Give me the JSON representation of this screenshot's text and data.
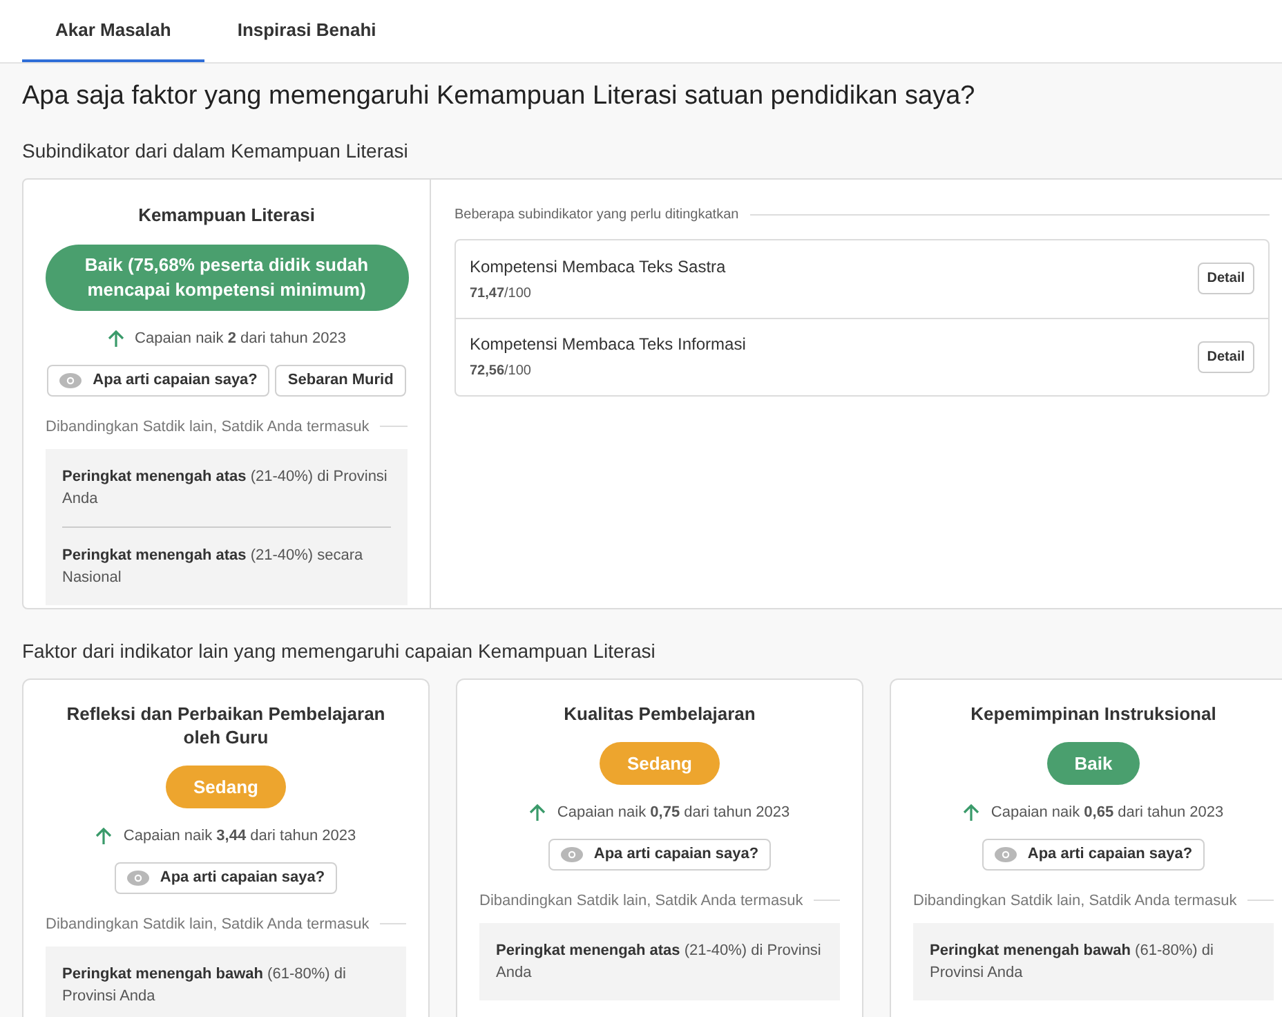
{
  "tabs": [
    {
      "label": "Akar Masalah",
      "selected": true
    },
    {
      "label": "Inspirasi Benahi",
      "selected": false
    }
  ],
  "title": "Apa saja faktor yang memengaruhi Kemampuan Literasi satuan pendidikan saya?",
  "main_section": {
    "heading": "Subindikator dari dalam Kemampuan Literasi",
    "summary": {
      "title": "Kemampuan Literasi",
      "badge": "Baik (75,68% peserta didik sudah mencapai kompetensi minimum)",
      "color": "#4a9f6e",
      "trend": "Capaian naik **2** dari tahun 2023",
      "buttons": [
        {
          "label": "Apa arti capaian saya?",
          "kind": "eye"
        },
        {
          "label": "Sebaran Murid",
          "kind": "plain"
        }
      ],
      "compare_label": "Dibandingkan Satdik lain, Satdik Anda termasuk",
      "ranks": [
        "**Peringkat menengah atas** (21-40%) di Provinsi Anda",
        "**Peringkat menengah atas** (21-40%) secara Nasional"
      ]
    },
    "subindicators_label": "Beberapa subindikator yang perlu ditingkatkan",
    "subindicators": [
      {
        "name": "Kompetensi Membaca Teks Sastra",
        "score": "**71,47**/100",
        "button": "Detail"
      },
      {
        "name": "Kompetensi Membaca Teks Informasi",
        "score": "**72,56**/100",
        "button": "Detail"
      }
    ]
  },
  "factors_section": {
    "heading": "Faktor dari indikator lain yang memengaruhi capaian Kemampuan Literasi",
    "cards": [
      {
        "title": "Refleksi dan Perbaikan Pembelajaran oleh Guru",
        "badge": "Sedang",
        "color": "#eda52e",
        "trend": "Capaian naik **3,44** dari tahun 2023",
        "button": "Apa arti capaian saya?",
        "compare_label": "Dibandingkan Satdik lain, Satdik Anda termasuk",
        "ranks": [
          "**Peringkat menengah bawah** (61-80%) di Provinsi Anda"
        ]
      },
      {
        "title": "Kualitas Pembelajaran",
        "badge": "Sedang",
        "color": "#eda52e",
        "trend": "Capaian naik **0,75** dari tahun 2023",
        "button": "Apa arti capaian saya?",
        "compare_label": "Dibandingkan Satdik lain, Satdik Anda termasuk",
        "ranks": [
          "**Peringkat menengah atas** (21-40%) di Provinsi Anda"
        ]
      },
      {
        "title": "Kepemimpinan Instruksional",
        "badge": "Baik",
        "color": "#4a9f6e",
        "trend": "Capaian naik **0,65** dari tahun 2023",
        "button": "Apa arti capaian saya?",
        "compare_label": "Dibandingkan Satdik lain, Satdik Anda termasuk",
        "ranks": [
          "**Peringkat menengah bawah** (61-80%) di Provinsi Anda"
        ]
      }
    ]
  }
}
